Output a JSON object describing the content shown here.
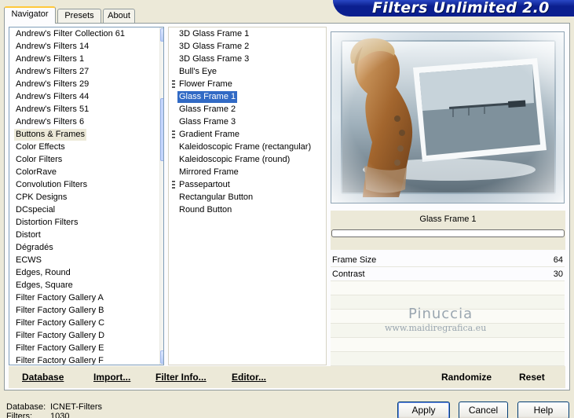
{
  "banner": {
    "title": "Filters Unlimited 2.0"
  },
  "tabs": [
    {
      "label": "Navigator"
    },
    {
      "label": "Presets"
    },
    {
      "label": "About"
    }
  ],
  "categories": [
    "Andrew's Filter Collection 61",
    "Andrew's Filters 14",
    "Andrew's Filters 1",
    "Andrew's Filters 27",
    "Andrew's Filters 29",
    "Andrew's Filters 44",
    "Andrew's Filters 51",
    "Andrew's Filters 6",
    "Buttons & Frames",
    "Color Effects",
    "Color Filters",
    "ColorRave",
    "Convolution Filters",
    "CPK Designs",
    "DCspecial",
    "Distortion Filters",
    "Distort",
    "Dégradés",
    "ECWS",
    "Edges, Round",
    "Edges, Square",
    "Filter Factory Gallery A",
    "Filter Factory Gallery B",
    "Filter Factory Gallery C",
    "Filter Factory Gallery D",
    "Filter Factory Gallery E",
    "Filter Factory Gallery F"
  ],
  "selected_category": "Buttons & Frames",
  "filters": [
    {
      "label": "3D Glass Frame 1",
      "marker": false
    },
    {
      "label": "3D Glass Frame 2",
      "marker": false
    },
    {
      "label": "3D Glass Frame 3",
      "marker": false
    },
    {
      "label": "Bull's Eye",
      "marker": false
    },
    {
      "label": "Flower Frame",
      "marker": true
    },
    {
      "label": "Glass Frame 1",
      "marker": false
    },
    {
      "label": "Glass Frame 2",
      "marker": false
    },
    {
      "label": "Glass Frame 3",
      "marker": false
    },
    {
      "label": "Gradient Frame",
      "marker": true
    },
    {
      "label": "Kaleidoscopic Frame (rectangular)",
      "marker": false
    },
    {
      "label": "Kaleidoscopic Frame (round)",
      "marker": false
    },
    {
      "label": "Mirrored Frame",
      "marker": false
    },
    {
      "label": "Passepartout",
      "marker": true
    },
    {
      "label": "Rectangular Button",
      "marker": false
    },
    {
      "label": "Round Button",
      "marker": false
    }
  ],
  "selected_filter": "Glass Frame 1",
  "preview": {
    "filter_name": "Glass Frame 1",
    "progress": 0
  },
  "params": [
    {
      "label": "Frame Size",
      "value": "64"
    },
    {
      "label": "Contrast",
      "value": "30"
    }
  ],
  "watermark": {
    "name": "Pinuccia",
    "url": "www.maidiregrafica.eu"
  },
  "toolbar": {
    "database": "Database",
    "import": "Import...",
    "filter_info": "Filter Info...",
    "editor": "Editor...",
    "randomize": "Randomize",
    "reset": "Reset"
  },
  "status": {
    "database_label": "Database:",
    "database_value": "ICNET-Filters",
    "filters_label": "Filters:",
    "filters_value": "1030"
  },
  "dialog": {
    "apply": "Apply",
    "cancel": "Cancel",
    "help": "Help"
  }
}
